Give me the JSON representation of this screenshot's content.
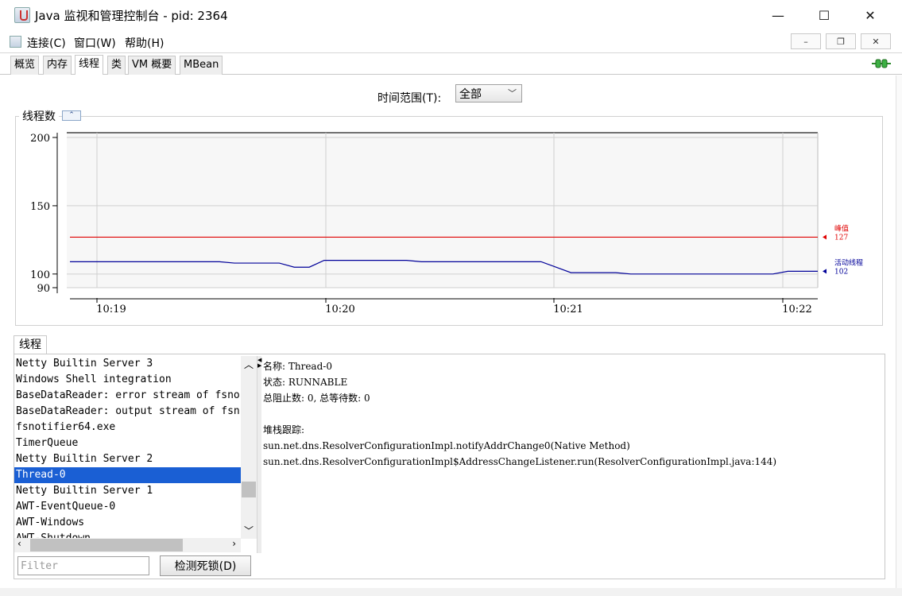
{
  "window": {
    "title": "Java 监视和管理控制台 - pid: 2364",
    "min_glyph": "—",
    "max_glyph": "☐",
    "close_glyph": "✕"
  },
  "menu": {
    "items": [
      "连接(C)",
      "窗口(W)",
      "帮助(H)"
    ],
    "mdi_min": "–",
    "mdi_restore": "❐",
    "mdi_close": "✕"
  },
  "tabs": [
    {
      "label": "概览",
      "active": false
    },
    {
      "label": "内存",
      "active": false
    },
    {
      "label": "线程",
      "active": true
    },
    {
      "label": "类",
      "active": false
    },
    {
      "label": "VM 概要",
      "active": false
    },
    {
      "label": "MBean",
      "active": false
    }
  ],
  "time_range": {
    "label": "时间范围(T):",
    "selected": "全部"
  },
  "chart_panel": {
    "title": "线程数",
    "collapse_glyph": "⌃"
  },
  "chart_data": {
    "type": "line",
    "title": "线程数",
    "xlabel": "",
    "ylabel": "",
    "x_ticks": [
      "10:19",
      "10:20",
      "10:21",
      "10:22"
    ],
    "y_ticks": [
      90,
      100,
      150,
      200
    ],
    "ylim": [
      90,
      200
    ],
    "grid": true,
    "series": [
      {
        "name": "峰值",
        "value_label": "127",
        "color": "#e00000",
        "x": [
          0,
          1
        ],
        "y": [
          127,
          127
        ]
      },
      {
        "name": "活动线程",
        "value_label": "102",
        "color": "#000099",
        "x": [
          0,
          0.2,
          0.22,
          0.28,
          0.3,
          0.32,
          0.34,
          0.45,
          0.47,
          0.63,
          0.65,
          0.67,
          0.73,
          0.75,
          0.94,
          0.96,
          1.0
        ],
        "y": [
          109,
          109,
          108,
          108,
          105,
          105,
          110,
          110,
          109,
          109,
          105,
          101,
          101,
          100,
          100,
          102,
          102
        ]
      }
    ]
  },
  "threads_tab": "线程",
  "threads": [
    "Netty Builtin Server 3",
    "Windows Shell integration",
    "BaseDataReader: error stream of fsno",
    "BaseDataReader: output stream of fsn",
    "fsnotifier64.exe",
    "TimerQueue",
    "Netty Builtin Server 2",
    "Thread-0",
    "Netty Builtin Server 1",
    "AWT-EventQueue-0",
    "AWT-Windows",
    "AWT-Shutdown"
  ],
  "selected_thread_index": 7,
  "details": {
    "name_line": "名称: Thread-0",
    "state_line": "状态: RUNNABLE",
    "counts_line": "总阻止数: 0, 总等待数: 0",
    "stack_label": "堆栈跟踪:",
    "stack": [
      "sun.net.dns.ResolverConfigurationImpl.notifyAddrChange0(Native Method)",
      "sun.net.dns.ResolverConfigurationImpl$AddressChangeListener.run(ResolverConfigurationImpl.java:144)"
    ]
  },
  "filter": {
    "placeholder": "Filter",
    "value": ""
  },
  "deadlock_button": "检测死锁(D)"
}
